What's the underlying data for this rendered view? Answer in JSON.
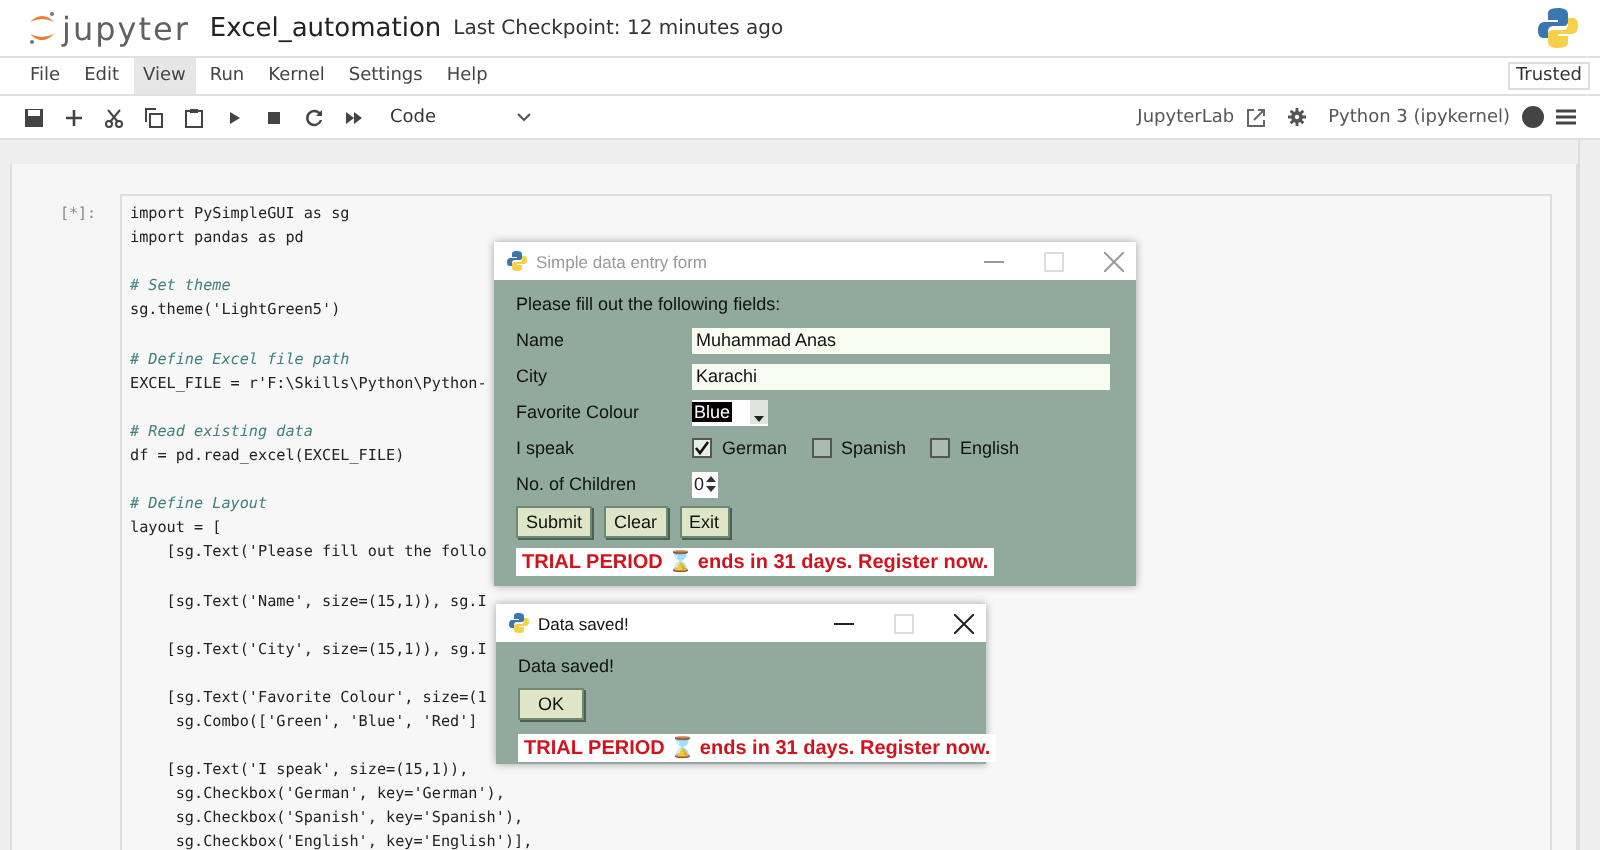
{
  "header": {
    "logo_text": "jupyter",
    "title": "Excel_automation",
    "checkpoint": "Last Checkpoint: 12 minutes ago"
  },
  "menu": [
    {
      "label": "File",
      "selected": false
    },
    {
      "label": "Edit",
      "selected": false
    },
    {
      "label": "View",
      "selected": true
    },
    {
      "label": "Run",
      "selected": false
    },
    {
      "label": "Kernel",
      "selected": false
    },
    {
      "label": "Settings",
      "selected": false
    },
    {
      "label": "Help",
      "selected": false
    }
  ],
  "trusted": "Trusted",
  "toolbar": {
    "cell_type": "Code",
    "lab_link": "JupyterLab",
    "kernel": "Python 3 (ipykernel)",
    "kernel_busy": true
  },
  "cell": {
    "prompt": "[*]:",
    "lines": [
      {
        "kind": "code",
        "text": "import PySimpleGUI as sg"
      },
      {
        "kind": "code",
        "text": "import pandas as pd"
      },
      {
        "kind": "blank"
      },
      {
        "kind": "comment",
        "text": "# Set theme"
      },
      {
        "kind": "code",
        "text": "sg.theme('LightGreen5')"
      },
      {
        "kind": "blank"
      },
      {
        "kind": "comment",
        "text": "# Define Excel file path"
      },
      {
        "kind": "code",
        "text": "EXCEL_FILE = r'F:\\Skills\\Python\\Python-"
      },
      {
        "kind": "blank"
      },
      {
        "kind": "comment",
        "text": "# Read existing data"
      },
      {
        "kind": "code",
        "text": "df = pd.read_excel(EXCEL_FILE)"
      },
      {
        "kind": "blank"
      },
      {
        "kind": "comment",
        "text": "# Define Layout"
      },
      {
        "kind": "code",
        "text": "layout = ["
      },
      {
        "kind": "code",
        "text": "    [sg.Text('Please fill out the follo"
      },
      {
        "kind": "blank"
      },
      {
        "kind": "code",
        "text": "    [sg.Text('Name', size=(15,1)), sg.I"
      },
      {
        "kind": "blank"
      },
      {
        "kind": "code",
        "text": "    [sg.Text('City', size=(15,1)), sg.I"
      },
      {
        "kind": "blank"
      },
      {
        "kind": "code",
        "text": "    [sg.Text('Favorite Colour', size=(1"
      },
      {
        "kind": "code",
        "text": "     sg.Combo(['Green', 'Blue', 'Red']"
      },
      {
        "kind": "blank"
      },
      {
        "kind": "code",
        "text": "    [sg.Text('I speak', size=(15,1)),"
      },
      {
        "kind": "code",
        "text": "     sg.Checkbox('German', key='German'),"
      },
      {
        "kind": "code",
        "text": "     sg.Checkbox('Spanish', key='Spanish'),"
      },
      {
        "kind": "code",
        "text": "     sg.Checkbox('English', key='English')],"
      }
    ]
  },
  "form_window": {
    "title": "Simple data entry form",
    "instruction": "Please fill out the following fields:",
    "rows": [
      {
        "kind": "text",
        "label": "Name",
        "value": "Muhammad Anas"
      },
      {
        "kind": "text",
        "label": "City",
        "value": "Karachi"
      },
      {
        "kind": "combo",
        "label": "Favorite Colour",
        "value": "Blue"
      },
      {
        "kind": "checkboxes",
        "label": "I speak",
        "options": [
          {
            "label": "German",
            "checked": true
          },
          {
            "label": "Spanish",
            "checked": false
          },
          {
            "label": "English",
            "checked": false
          }
        ]
      },
      {
        "kind": "spin",
        "label": "No. of Children",
        "value": "0"
      }
    ],
    "buttons": [
      "Submit",
      "Clear",
      "Exit"
    ],
    "trial": "TRIAL PERIOD ⌛ ends in 31 days. Register now."
  },
  "popup_window": {
    "title": "Data saved!",
    "message": "Data saved!",
    "button": "OK",
    "trial": "TRIAL PERIOD ⌛ ends in 31 days. Register now."
  }
}
